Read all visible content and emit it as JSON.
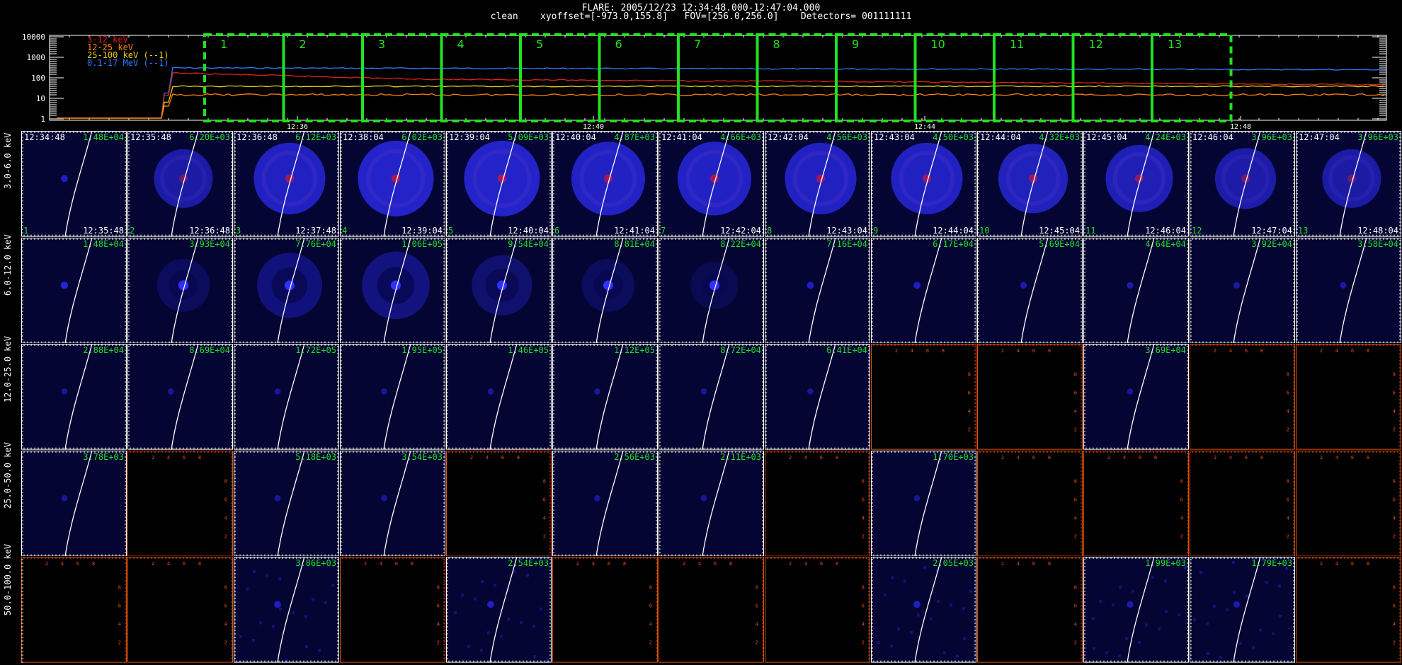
{
  "header": {
    "line1": "FLARE: 2005/12/23 12:34:48.000-12:47:04.000",
    "line2": "clean    xyoffset=[-973.0,155.8]   FOV=[256.0,256.0]    Detectors= 001111111"
  },
  "lightcurve": {
    "y_ticks": [
      "10000",
      "1000",
      "100",
      "10",
      "1"
    ],
    "x_ticks": [
      "12:36",
      "12:40",
      "12:44",
      "12:48"
    ],
    "legend": [
      {
        "label": "3-12 keV",
        "color": "#e02020"
      },
      {
        "label": "12-25 keV",
        "color": "#ff7f10"
      },
      {
        "label": "25-100 keV (--1)",
        "color": "#e8d010"
      },
      {
        "label": "0.1-17 MeV (--1)",
        "color": "#2f7bff"
      }
    ],
    "intervals": [
      "1",
      "2",
      "3",
      "4",
      "5",
      "6",
      "7",
      "8",
      "9",
      "10",
      "11",
      "12",
      "13"
    ]
  },
  "rows": [
    {
      "label": "3.0-6.0 keV"
    },
    {
      "label": "6.0-12.0 keV"
    },
    {
      "label": "12.0-25.0 keV"
    },
    {
      "label": "25.0-50.0 keV"
    },
    {
      "label": "50.0-100.0 keV"
    }
  ],
  "row1_start_times": [
    "12:34:48",
    "12:35:48",
    "12:36:48",
    "12:38:04",
    "12:39:04",
    "12:40:04",
    "12:41:04",
    "12:42:04",
    "12:43:04",
    "12:44:04",
    "12:45:04",
    "12:46:04",
    "12:47:04"
  ],
  "row1_end_times": [
    "12:35:48",
    "12:36:48",
    "12:37:48",
    "12:39:04",
    "12:40:04",
    "12:41:04",
    "12:42:04",
    "12:43:04",
    "12:44:04",
    "12:45:04",
    "12:46:04",
    "12:47:04",
    "12:48:04"
  ],
  "row1_indices": [
    "1",
    "2",
    "3",
    "4",
    "5",
    "6",
    "7",
    "8",
    "9",
    "10",
    "11",
    "12",
    "13"
  ],
  "cell_values": [
    [
      "1.48E+04",
      "6.20E+03",
      "6.12E+03",
      "6.02E+03",
      "5.09E+03",
      "4.87E+03",
      "4.66E+03",
      "4.56E+03",
      "4.50E+03",
      "4.32E+03",
      "4.24E+03",
      "3.96E+03",
      "3.96E+03"
    ],
    [
      "1.48E+04",
      "3.93E+04",
      "7.76E+04",
      "1.06E+05",
      "9.54E+04",
      "8.81E+04",
      "8.22E+04",
      "7.16E+04",
      "6.17E+04",
      "5.69E+04",
      "4.64E+04",
      "3.92E+04",
      "3.58E+04"
    ],
    [
      "2.88E+04",
      "8.69E+04",
      "1.72E+05",
      "1.95E+05",
      "1.46E+05",
      "1.12E+05",
      "8.72E+04",
      "6.41E+04",
      "",
      "",
      "3.69E+04",
      "",
      ""
    ],
    [
      "3.78E+03",
      "",
      "5.18E+03",
      "3.54E+03",
      "",
      "2.56E+03",
      "2.11E+03",
      "",
      "1.70E+03",
      "",
      "",
      "",
      ""
    ],
    [
      "",
      "",
      "3.86E+03",
      "",
      "2.54E+03",
      "",
      "",
      "",
      "2.05E+03",
      "",
      "1.99E+03",
      "1.79E+03",
      ""
    ]
  ],
  "blob_strength": [
    [
      0.15,
      0.55,
      0.85,
      0.95,
      0.95,
      0.9,
      0.9,
      0.85,
      0.85,
      0.8,
      0.75,
      0.6,
      0.55
    ],
    [
      0.2,
      0.35,
      0.6,
      0.65,
      0.5,
      0.35,
      0.25,
      0.15,
      0.15,
      0.1,
      0.1,
      0.08,
      0.08
    ],
    [
      0.05,
      0.05,
      0.05,
      0.05,
      0.05,
      0.05,
      0.05,
      0.05,
      0,
      0,
      0.05,
      0,
      0
    ],
    [
      0.05,
      0,
      0.05,
      0.05,
      0,
      0.05,
      0.05,
      0,
      0.05,
      0,
      0,
      0,
      0
    ],
    [
      0,
      0,
      0.15,
      0,
      0.15,
      0,
      0,
      0,
      0.15,
      0,
      0.1,
      0.1,
      0
    ]
  ],
  "empty_axis_ticks": [
    "2",
    "4",
    "6",
    "8"
  ],
  "colors": {
    "interval_box": "#22e022",
    "cell_label": "#22e022",
    "empty_axis": "#e0500c",
    "image_bg": "#050534",
    "limb": "#ffffff"
  }
}
